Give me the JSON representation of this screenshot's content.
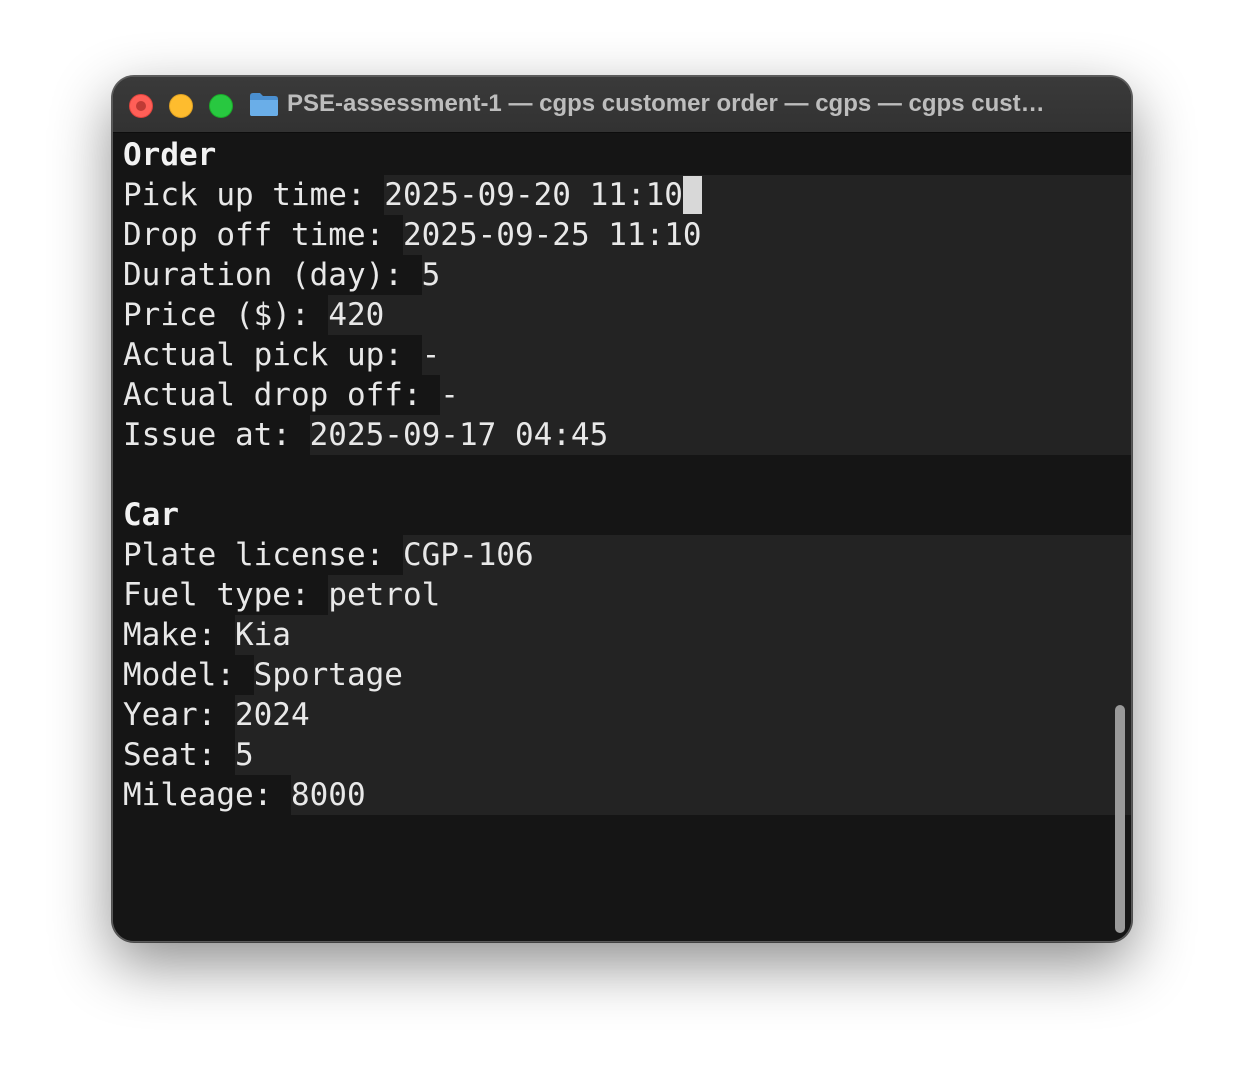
{
  "window": {
    "title": "PSE-assessment-1 — cgps customer order — cgps — cgps cust…"
  },
  "order": {
    "heading": "Order",
    "fields": [
      {
        "label": "Pick up time: ",
        "value": "2025-09-20 11:10"
      },
      {
        "label": "Drop off time: ",
        "value": "2025-09-25 11:10"
      },
      {
        "label": "Duration (day): ",
        "value": "5"
      },
      {
        "label": "Price ($): ",
        "value": "420"
      },
      {
        "label": "Actual pick up: ",
        "value": "-"
      },
      {
        "label": "Actual drop off: ",
        "value": "-"
      },
      {
        "label": "Issue at: ",
        "value": "2025-09-17 04:45"
      }
    ]
  },
  "car": {
    "heading": "Car",
    "fields": [
      {
        "label": "Plate license: ",
        "value": "CGP-106"
      },
      {
        "label": "Fuel type: ",
        "value": "petrol"
      },
      {
        "label": "Make: ",
        "value": "Kia"
      },
      {
        "label": "Model: ",
        "value": "Sportage"
      },
      {
        "label": "Year: ",
        "value": "2024"
      },
      {
        "label": "Seat: ",
        "value": "5"
      },
      {
        "label": "Mileage: ",
        "value": "8000"
      }
    ]
  },
  "icons": {
    "folder": "folder-icon",
    "cursor": "block-cursor"
  },
  "colors": {
    "close": "#ff5f57",
    "minimize": "#febc2e",
    "zoom": "#28c840",
    "terminal_bg": "#151515",
    "value_bg": "#232323",
    "text": "#e8e8e8"
  }
}
